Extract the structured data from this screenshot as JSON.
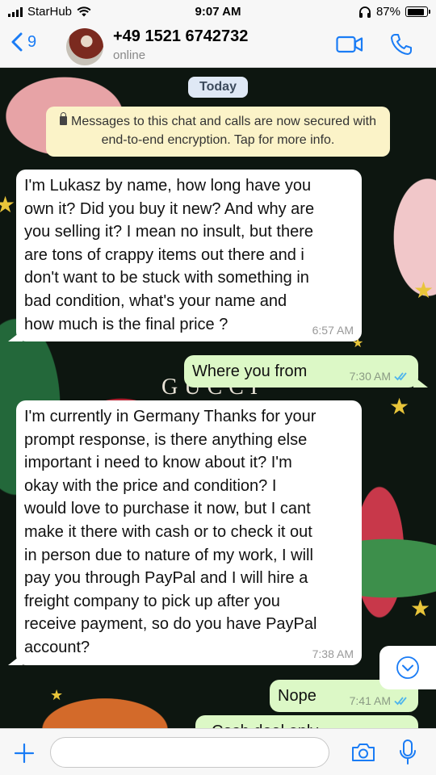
{
  "status_bar": {
    "carrier": "StarHub",
    "time": "9:07 AM",
    "battery": "87%",
    "battery_level": 0.87
  },
  "header": {
    "back_count": "9",
    "contact_name": "+49 1521 6742732",
    "contact_status": "online"
  },
  "chat": {
    "day_label": "Today",
    "system_message": "Messages to this chat and calls are now secured with end-to-end encryption. Tap for more info.",
    "wallpaper_text": "GUCCI",
    "messages": [
      {
        "direction": "in",
        "lines": [
          "I'm Lukasz by name, how long have you",
          "own it? Did you buy it new? And why are",
          "you selling it? I mean no insult, but there",
          "are tons of crappy items out there and i",
          "don't want to be stuck with something in",
          "bad condition, what's your name and",
          "how much is the final price ?"
        ],
        "time": "6:57 AM"
      },
      {
        "direction": "out",
        "lines": [
          "Where you from"
        ],
        "time": "7:30 AM"
      },
      {
        "direction": "in",
        "lines": [
          "I'm currently in Germany Thanks for your",
          "prompt response, is there anything else",
          "important i need to know about it?  I'm",
          "okay with the price and condition? I",
          "would love to purchase it now, but I cant",
          "make it there with cash or to check it out",
          "in person due to nature of my work, I will",
          "pay you through PayPal and I will hire a",
          "freight company to pick up after you",
          "receive payment, so do you have PayPal",
          "account?"
        ],
        "time": "7:38 AM"
      },
      {
        "direction": "out",
        "lines": [
          "Nope"
        ],
        "time": "7:41 AM"
      },
      {
        "direction": "out",
        "lines": [
          "Cash deal only"
        ],
        "time": ""
      }
    ]
  },
  "input_bar": {
    "placeholder": ""
  },
  "icons": [
    "signal-icon",
    "wifi-icon",
    "headphones-icon",
    "battery-icon",
    "back-chevron-icon",
    "video-call-icon",
    "phone-icon",
    "lock-icon",
    "read-receipt-icon",
    "scroll-down-icon",
    "plus-icon",
    "camera-icon",
    "microphone-icon"
  ],
  "colors": {
    "accent": "#1a7cf5",
    "outgoing_bubble": "#dcf8c6",
    "incoming_bubble": "#ffffff",
    "system_notice": "#fbf3c8",
    "read_tick": "#4fb5ec"
  }
}
